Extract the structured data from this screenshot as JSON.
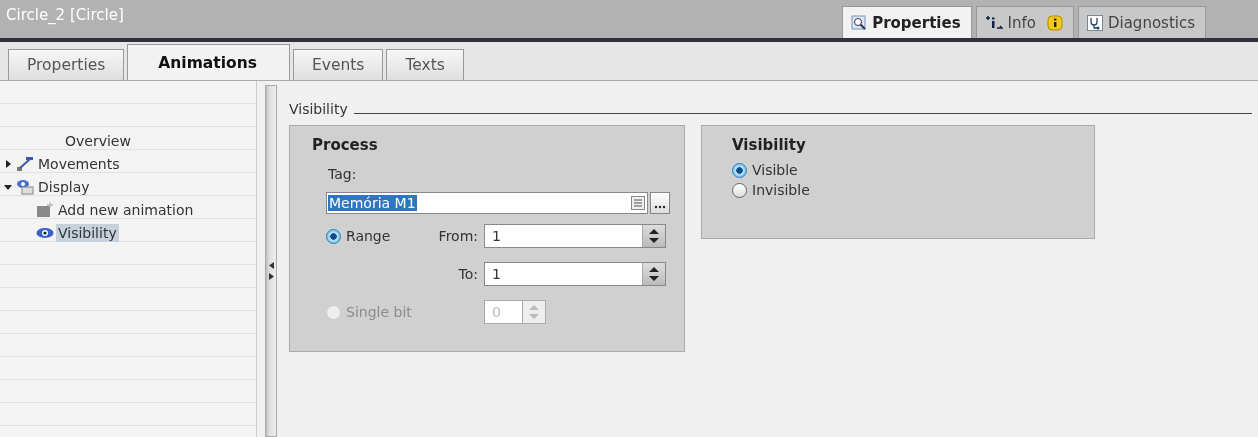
{
  "window": {
    "title": "Circle_2 [Circle]"
  },
  "inspector_tabs": [
    {
      "label": "Properties",
      "selected": true,
      "kind": "properties"
    },
    {
      "label": "Info",
      "selected": false,
      "kind": "info"
    },
    {
      "label": "Diagnostics",
      "selected": false,
      "kind": "diagnostics"
    }
  ],
  "tabs": [
    {
      "label": "Properties",
      "selected": false
    },
    {
      "label": "Animations",
      "selected": true
    },
    {
      "label": "Events",
      "selected": false
    },
    {
      "label": "Texts",
      "selected": false
    }
  ],
  "tree": [
    {
      "label": "Overview",
      "kind": "plain",
      "selected": false
    },
    {
      "label": "Movements",
      "kind": "movements",
      "selected": false,
      "expanded": false
    },
    {
      "label": "Display",
      "kind": "display",
      "selected": false,
      "expanded": true,
      "children": [
        {
          "label": "Add new animation",
          "kind": "add",
          "selected": false
        },
        {
          "label": "Visibility",
          "kind": "visibility",
          "selected": true
        }
      ]
    }
  ],
  "section_title": "Visibility",
  "process": {
    "title": "Process",
    "tag_label": "Tag:",
    "tag_value": "Memória M1",
    "range": {
      "label": "Range",
      "selected": true,
      "disabled": false
    },
    "from_label": "From:",
    "from_value": "1",
    "to_label": "To:",
    "to_value": "1",
    "single_bit": {
      "label": "Single bit",
      "selected": false,
      "disabled": true,
      "value": "0"
    }
  },
  "visibility": {
    "title": "Visibility",
    "options": [
      {
        "label": "Visible",
        "selected": true
      },
      {
        "label": "Invisible",
        "selected": false
      }
    ]
  }
}
